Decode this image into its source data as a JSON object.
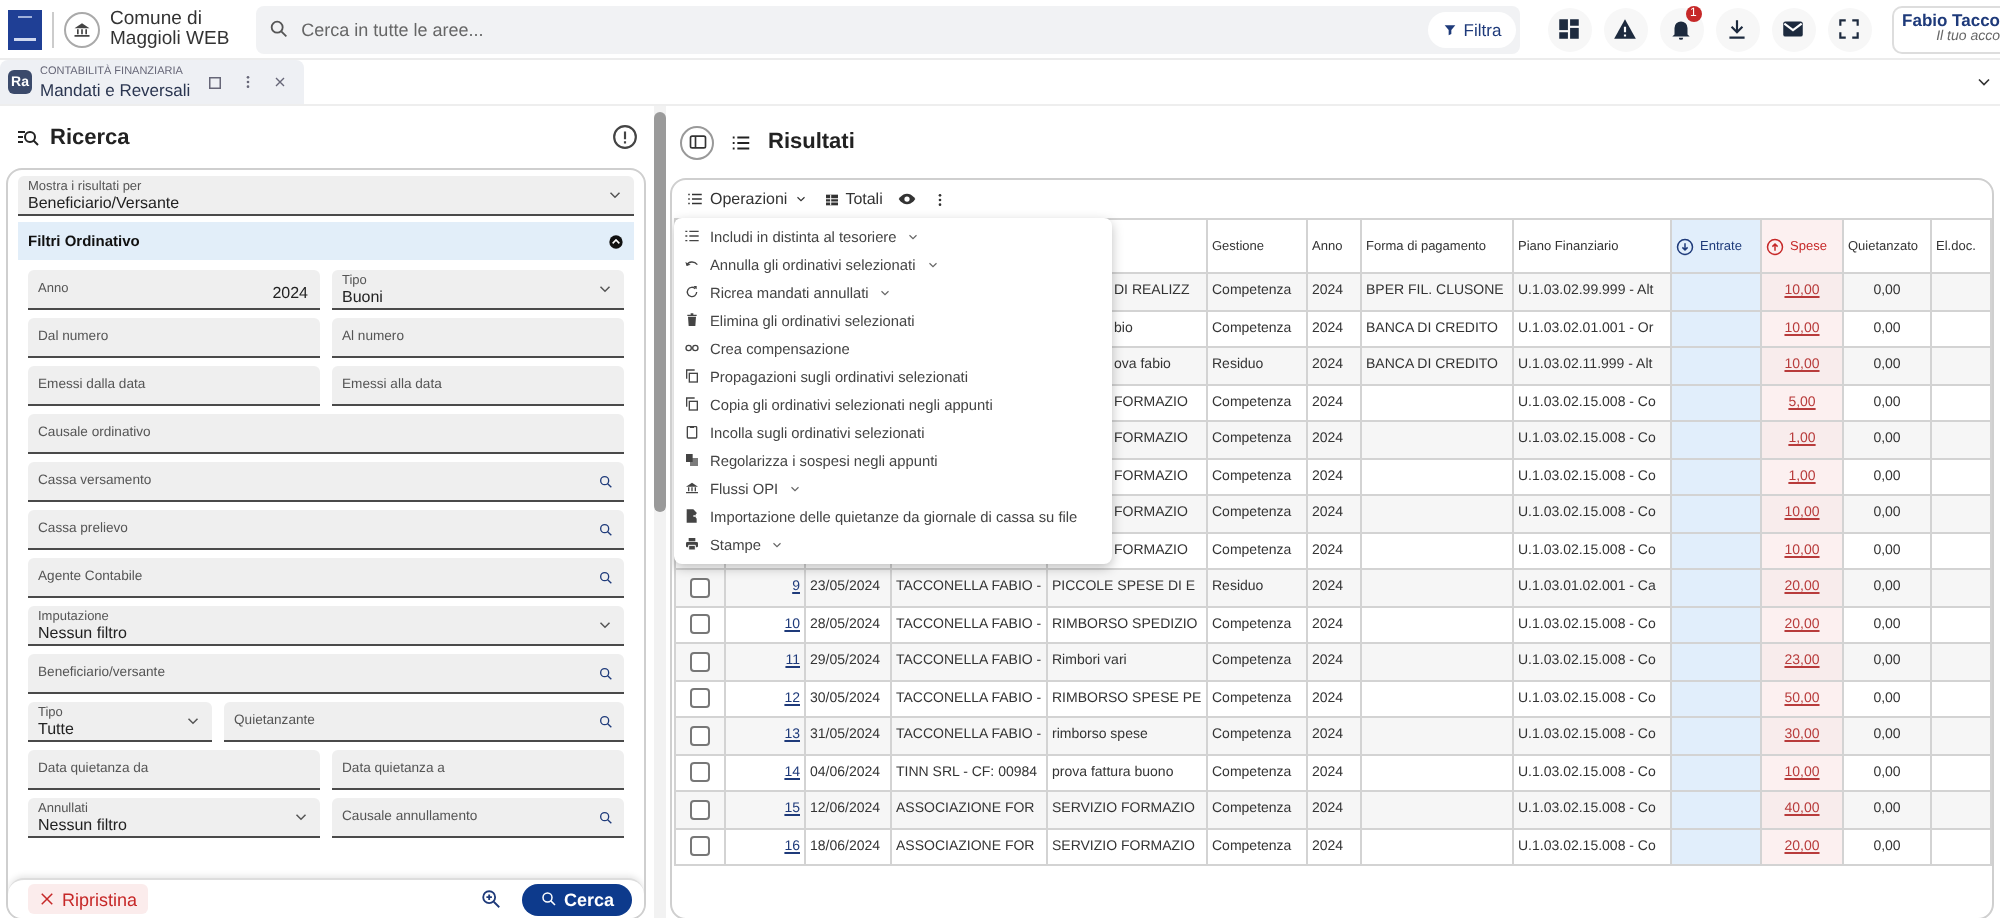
{
  "topbar": {
    "org_line1": "Comune di",
    "org_line2": "Maggioli WEB",
    "search": {
      "placeholder": "Cerca in tutte le aree..."
    },
    "filter_button": "Filtra",
    "notifications_badge": "1",
    "user": {
      "name": "Fabio Tacco",
      "subtitle": "Il tuo acco"
    }
  },
  "tab": {
    "icon_text": "Ra",
    "module": "CONTABILITÀ FINANZIARIA",
    "title": "Mandati e Reversali"
  },
  "search_panel": {
    "title": "Ricerca",
    "show_by": {
      "label": "Mostra i risultati per",
      "value": "Beneficiario/Versante"
    },
    "filters": {
      "title": "Filtri Ordinativo",
      "expanded": true,
      "rows": [
        {
          "kind": "pair",
          "fields": [
            {
              "kind": "number",
              "label": "Anno",
              "value": "2024"
            },
            {
              "kind": "select",
              "label": "Tipo",
              "value": "Buoni"
            }
          ]
        },
        {
          "kind": "pair",
          "fields": [
            {
              "kind": "text",
              "label": "Dal numero"
            },
            {
              "kind": "text",
              "label": "Al numero"
            }
          ]
        },
        {
          "kind": "pair",
          "fields": [
            {
              "kind": "text",
              "label": "Emessi dalla data"
            },
            {
              "kind": "text",
              "label": "Emessi alla data"
            }
          ]
        },
        {
          "kind": "single",
          "fields": [
            {
              "kind": "text",
              "label": "Causale ordinativo"
            }
          ]
        },
        {
          "kind": "single",
          "fields": [
            {
              "kind": "lookup",
              "label": "Cassa versamento"
            }
          ]
        },
        {
          "kind": "single",
          "fields": [
            {
              "kind": "lookup",
              "label": "Cassa prelievo"
            }
          ]
        },
        {
          "kind": "single",
          "fields": [
            {
              "kind": "lookup",
              "label": "Agente Contabile"
            }
          ]
        },
        {
          "kind": "single",
          "fields": [
            {
              "kind": "select",
              "label": "Imputazione",
              "value": "Nessun filtro"
            }
          ]
        },
        {
          "kind": "single",
          "fields": [
            {
              "kind": "lookup",
              "label": "Beneficiario/versante"
            }
          ]
        },
        {
          "kind": "narrow",
          "fields": [
            {
              "kind": "select",
              "label": "Tipo",
              "value": "Tutte"
            },
            {
              "kind": "lookup",
              "label": "Quietanzante"
            }
          ]
        },
        {
          "kind": "pair",
          "fields": [
            {
              "kind": "text",
              "label": "Data quietanza da"
            },
            {
              "kind": "text",
              "label": "Data quietanza a"
            }
          ]
        },
        {
          "kind": "pair",
          "fields": [
            {
              "kind": "select",
              "label": "Annullati",
              "value": "Nessun filtro"
            },
            {
              "kind": "lookup",
              "label": "Causale annullamento"
            }
          ]
        }
      ]
    },
    "reset_button": "Ripristina",
    "search_button": "Cerca"
  },
  "results": {
    "title": "Risultati",
    "toolbar": {
      "operations": "Operazioni",
      "totals": "Totali"
    },
    "menu": {
      "open": true,
      "items": [
        {
          "label": "Includi in distinta al tesoriere",
          "submenu": true
        },
        {
          "label": "Annulla gli ordinativi selezionati",
          "submenu": true
        },
        {
          "label": "Ricrea mandati annullati",
          "submenu": true
        },
        {
          "label": "Elimina gli ordinativi selezionati",
          "submenu": false
        },
        {
          "label": "Crea compensazione",
          "submenu": false
        },
        {
          "label": "Propagazioni sugli ordinativi selezionati",
          "submenu": false
        },
        {
          "label": "Copia gli ordinativi selezionati negli appunti",
          "submenu": false
        },
        {
          "label": "Incolla sugli ordinativi selezionati",
          "submenu": false
        },
        {
          "label": "Regolarizza i sospesi negli appunti",
          "submenu": false
        },
        {
          "label": "Flussi OPI",
          "submenu": true
        },
        {
          "label": "Importazione delle quietanze da giornale di cassa su file",
          "submenu": false
        },
        {
          "label": "Stampe",
          "submenu": true
        }
      ]
    },
    "table": {
      "columns": [
        {
          "kind": "text",
          "label": "Gestione"
        },
        {
          "kind": "text",
          "label": "Anno"
        },
        {
          "kind": "text",
          "label": "Forma di pagamento"
        },
        {
          "kind": "text",
          "label": "Piano Finanziario"
        },
        {
          "kind": "revenue",
          "label": "Entrate"
        },
        {
          "kind": "expense",
          "label": "Spese"
        },
        {
          "kind": "text",
          "label": "Quietanzato"
        },
        {
          "kind": "text",
          "label": "El.doc."
        }
      ],
      "rows": [
        {
          "description": "DI REALIZZ",
          "management": "Competenza",
          "year": "2024",
          "payment_form": "BPER FIL. CLUSONE",
          "plan": "U.1.03.02.99.999 - Alt",
          "expense": "10,00",
          "paid": "0,00"
        },
        {
          "description": "bio",
          "management": "Competenza",
          "year": "2024",
          "payment_form": "BANCA DI CREDITO",
          "plan": "U.1.03.02.01.001 - Or",
          "expense": "10,00",
          "paid": "0,00"
        },
        {
          "description": "ova fabio",
          "management": "Residuo",
          "year": "2024",
          "payment_form": "BANCA DI CREDITO",
          "plan": "U.1.03.02.11.999 - Alt",
          "expense": "10,00",
          "paid": "0,00"
        },
        {
          "description": "FORMAZIO",
          "management": "Competenza",
          "year": "2024",
          "plan": "U.1.03.02.15.008 - Co",
          "expense": "5,00",
          "paid": "0,00"
        },
        {
          "description": "FORMAZIO",
          "management": "Competenza",
          "year": "2024",
          "plan": "U.1.03.02.15.008 - Co",
          "expense": "1,00",
          "paid": "0,00"
        },
        {
          "description": "FORMAZIO",
          "management": "Competenza",
          "year": "2024",
          "plan": "U.1.03.02.15.008 - Co",
          "expense": "1,00",
          "paid": "0,00"
        },
        {
          "description": "FORMAZIO",
          "management": "Competenza",
          "year": "2024",
          "plan": "U.1.03.02.15.008 - Co",
          "expense": "10,00",
          "paid": "0,00"
        },
        {
          "description": "FORMAZIO",
          "management": "Competenza",
          "year": "2024",
          "plan": "U.1.03.02.15.008 - Co",
          "expense": "10,00",
          "paid": "0,00"
        },
        {
          "checked": false,
          "number": "9",
          "date": "23/05/2024",
          "beneficiary": "TACCONELLA FABIO -",
          "description": "PICCOLE SPESE DI E",
          "management": "Residuo",
          "year": "2024",
          "plan": "U.1.03.01.02.001 - Ca",
          "expense": "20,00",
          "paid": "0,00"
        },
        {
          "checked": false,
          "number": "10",
          "date": "28/05/2024",
          "beneficiary": "TACCONELLA FABIO -",
          "description": "RIMBORSO SPEDIZIO",
          "management": "Competenza",
          "year": "2024",
          "plan": "U.1.03.02.15.008 - Co",
          "expense": "20,00",
          "paid": "0,00"
        },
        {
          "checked": false,
          "number": "11",
          "date": "29/05/2024",
          "beneficiary": "TACCONELLA FABIO -",
          "description": "Rimbori vari",
          "management": "Competenza",
          "year": "2024",
          "plan": "U.1.03.02.15.008 - Co",
          "expense": "23,00",
          "paid": "0,00"
        },
        {
          "checked": false,
          "number": "12",
          "date": "30/05/2024",
          "beneficiary": "TACCONELLA FABIO -",
          "description": "RIMBORSO SPESE PE",
          "management": "Competenza",
          "year": "2024",
          "plan": "U.1.03.02.15.008 - Co",
          "expense": "50,00",
          "paid": "0,00"
        },
        {
          "checked": false,
          "number": "13",
          "date": "31/05/2024",
          "beneficiary": "TACCONELLA FABIO -",
          "description": "rimborso spese",
          "management": "Competenza",
          "year": "2024",
          "plan": "U.1.03.02.15.008 - Co",
          "expense": "30,00",
          "paid": "0,00"
        },
        {
          "checked": false,
          "number": "14",
          "date": "04/06/2024",
          "beneficiary": "TINN SRL - CF: 00984",
          "description": "prova fattura buono",
          "management": "Competenza",
          "year": "2024",
          "plan": "U.1.03.02.15.008 - Co",
          "expense": "10,00",
          "paid": "0,00"
        },
        {
          "checked": false,
          "number": "15",
          "date": "12/06/2024",
          "beneficiary": "ASSOCIAZIONE FOR",
          "description": "SERVIZIO FORMAZIO",
          "management": "Competenza",
          "year": "2024",
          "plan": "U.1.03.02.15.008 - Co",
          "expense": "40,00",
          "paid": "0,00"
        },
        {
          "checked": false,
          "number": "16",
          "date": "18/06/2024",
          "beneficiary": "ASSOCIAZIONE FOR",
          "description": "SERVIZIO FORMAZIO",
          "management": "Competenza",
          "year": "2024",
          "plan": "U.1.03.02.15.008 - Co",
          "expense": "20,00",
          "paid": "0,00"
        }
      ]
    }
  }
}
